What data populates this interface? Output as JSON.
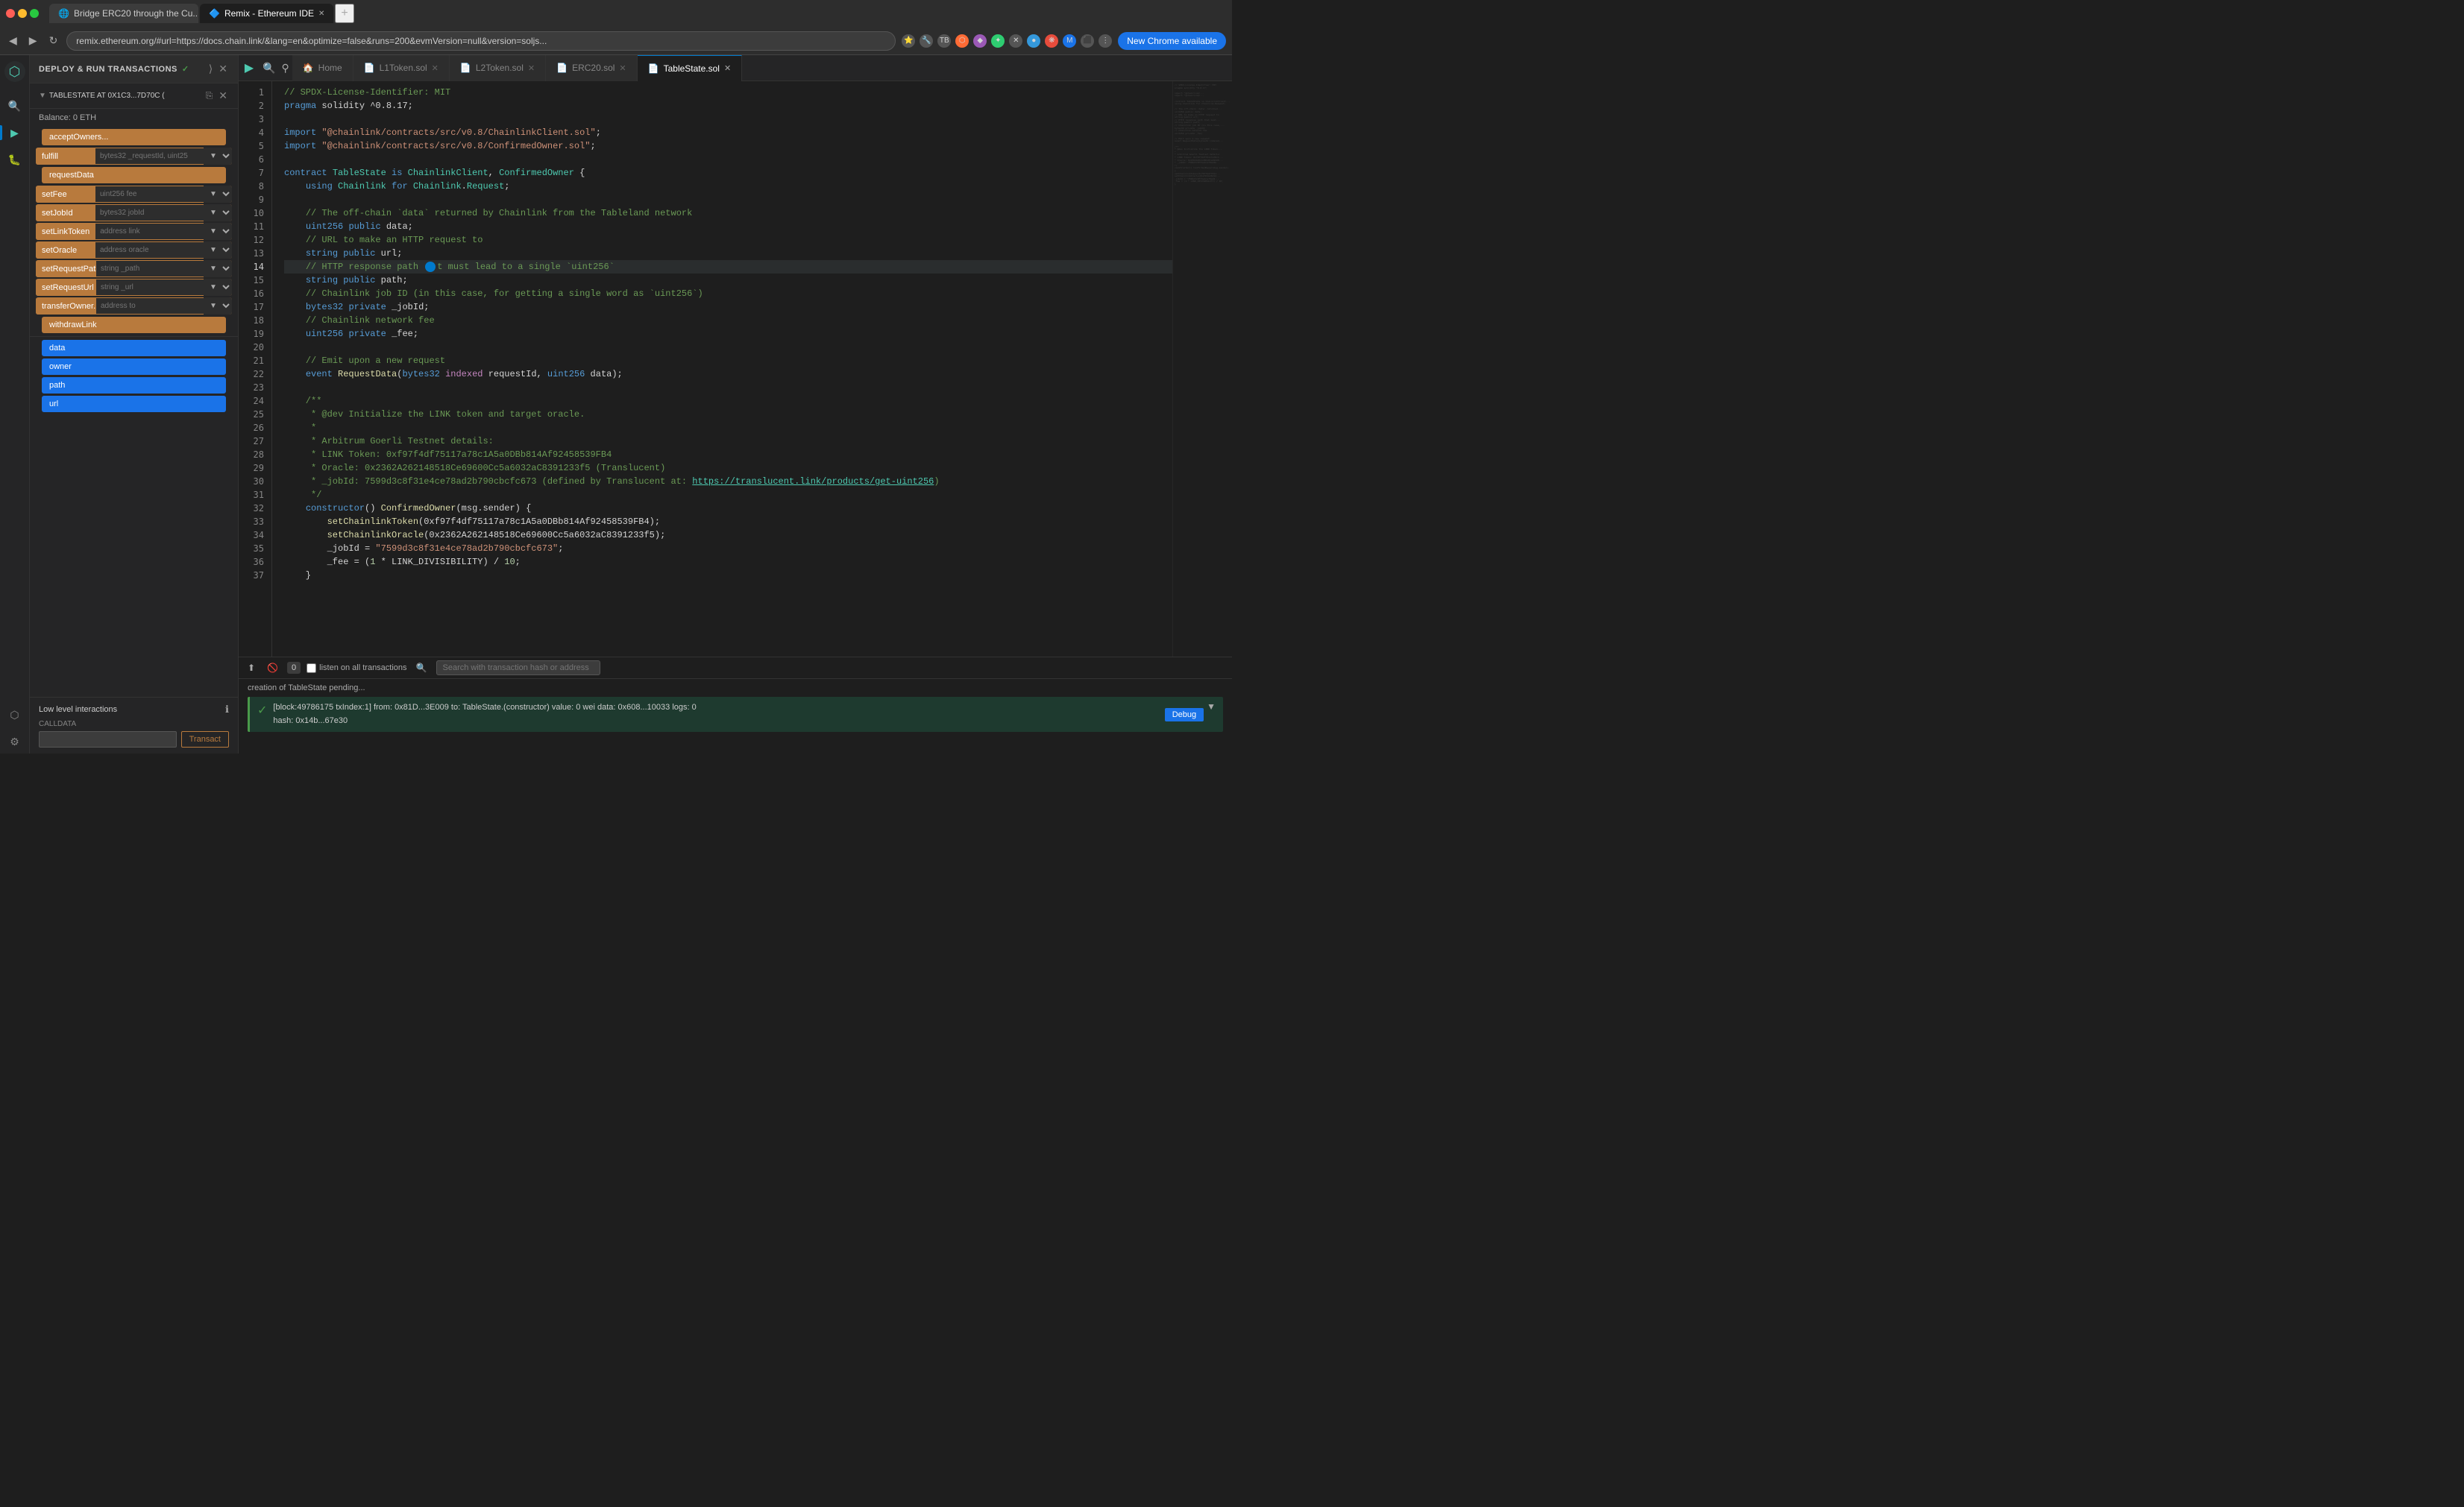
{
  "browser": {
    "tabs": [
      {
        "id": "tab1",
        "title": "Bridge ERC20 through the Cu...",
        "favicon": "🌐",
        "active": false
      },
      {
        "id": "tab2",
        "title": "Remix - Ethereum IDE",
        "favicon": "🔷",
        "active": true
      }
    ],
    "address": "remix.ethereum.org/#url=https://docs.chain.link/&lang=en&optimize=false&runs=200&evmVersion=null&version=soljs...",
    "new_chrome_label": "New Chrome available",
    "nav": {
      "back": "◀",
      "forward": "▶",
      "refresh": "↻",
      "home": "⌂"
    }
  },
  "panel": {
    "title": "DEPLOY & RUN TRANSACTIONS",
    "check_icon": "✓",
    "contract_name": "TABLESTATE AT 0X1C3...7D70C (",
    "balance": "Balance: 0 ETH",
    "buttons": [
      {
        "id": "acceptOwners",
        "label": "acceptOwners...",
        "type": "orange",
        "has_input": false
      },
      {
        "id": "fulfill",
        "label": "fulfill",
        "type": "orange",
        "has_input": true,
        "placeholder": "bytes32 _requestId, uint25"
      },
      {
        "id": "requestData",
        "label": "requestData",
        "type": "orange",
        "has_input": false
      },
      {
        "id": "setFee",
        "label": "setFee",
        "type": "orange",
        "has_input": true,
        "placeholder": "uint256 fee"
      },
      {
        "id": "setJobId",
        "label": "setJobId",
        "type": "orange",
        "has_input": true,
        "placeholder": "bytes32 jobId"
      },
      {
        "id": "setLinkToken",
        "label": "setLinkToken",
        "type": "orange",
        "has_input": true,
        "placeholder": "address link"
      },
      {
        "id": "setOracle",
        "label": "setOracle",
        "type": "orange",
        "has_input": true,
        "placeholder": "address oracle"
      },
      {
        "id": "setRequestPath",
        "label": "setRequestPath",
        "type": "orange",
        "has_input": true,
        "placeholder": "string _path"
      },
      {
        "id": "setRequestUrl",
        "label": "setRequestUrl",
        "type": "orange",
        "has_input": true,
        "placeholder": "string _url"
      },
      {
        "id": "transferOwner...",
        "label": "transferOwner...",
        "type": "orange",
        "has_input": true,
        "placeholder": "address to"
      },
      {
        "id": "withdrawLink",
        "label": "withdrawLink",
        "type": "orange",
        "has_input": false
      },
      {
        "id": "data",
        "label": "data",
        "type": "blue",
        "has_input": false
      },
      {
        "id": "owner",
        "label": "owner",
        "type": "blue",
        "has_input": false
      },
      {
        "id": "path",
        "label": "path",
        "type": "blue",
        "has_input": false
      },
      {
        "id": "url",
        "label": "url",
        "type": "blue",
        "has_input": false
      }
    ],
    "low_level": {
      "title": "Low level interactions",
      "calldata_label": "CALLDATA",
      "transact_label": "Transact"
    }
  },
  "editor": {
    "tabs": [
      {
        "id": "home",
        "label": "Home",
        "icon": "🏠",
        "active": false
      },
      {
        "id": "l1token",
        "label": "L1Token.sol",
        "icon": "📄",
        "active": false
      },
      {
        "id": "l2token",
        "label": "L2Token.sol",
        "icon": "📄",
        "active": false
      },
      {
        "id": "erc20",
        "label": "ERC20.sol",
        "icon": "📄",
        "active": false
      },
      {
        "id": "tablestate",
        "label": "TableState.sol",
        "icon": "📄",
        "active": true
      }
    ],
    "code_lines": [
      {
        "num": 1,
        "text": "// SPDX-License-Identifier: MIT"
      },
      {
        "num": 2,
        "text": "pragma solidity ^0.8.17;"
      },
      {
        "num": 3,
        "text": ""
      },
      {
        "num": 4,
        "text": "import \"@chainlink/contracts/src/v0.8/ChainlinkClient.sol\";"
      },
      {
        "num": 5,
        "text": "import \"@chainlink/contracts/src/v0.8/ConfirmedOwner.sol\";"
      },
      {
        "num": 6,
        "text": ""
      },
      {
        "num": 7,
        "text": "contract TableState is ChainlinkClient, ConfirmedOwner {"
      },
      {
        "num": 8,
        "text": "    using Chainlink for Chainlink.Request;"
      },
      {
        "num": 9,
        "text": ""
      },
      {
        "num": 10,
        "text": "    // The off-chain `data` returned by Chainlink from the Tableland network"
      },
      {
        "num": 11,
        "text": "    uint256 public data;"
      },
      {
        "num": 12,
        "text": "    // URL to make an HTTP request to"
      },
      {
        "num": 13,
        "text": "    string public url;"
      },
      {
        "num": 14,
        "text": "    // HTTP response path that must lead to a single `uint256`",
        "highlighted": true
      },
      {
        "num": 15,
        "text": "    string public path;"
      },
      {
        "num": 16,
        "text": "    // Chainlink job ID (in this case, for getting a single word as `uint256`)"
      },
      {
        "num": 17,
        "text": "    bytes32 private _jobId;"
      },
      {
        "num": 18,
        "text": "    // Chainlink network fee"
      },
      {
        "num": 19,
        "text": "    uint256 private _fee;"
      },
      {
        "num": 20,
        "text": ""
      },
      {
        "num": 21,
        "text": "    // Emit upon a new request"
      },
      {
        "num": 22,
        "text": "    event RequestData(bytes32 indexed requestId, uint256 data);"
      },
      {
        "num": 23,
        "text": ""
      },
      {
        "num": 24,
        "text": "    /**"
      },
      {
        "num": 25,
        "text": "     * @dev Initialize the LINK token and target oracle."
      },
      {
        "num": 26,
        "text": "     *"
      },
      {
        "num": 27,
        "text": "     * Arbitrum Goerli Testnet details:"
      },
      {
        "num": 28,
        "text": "     * LINK Token: 0xf97f4df75117a78c1A5a0DBb814Af92458539FB4"
      },
      {
        "num": 29,
        "text": "     * Oracle: 0x2362A262148518Ce69600Cc5a6032aC8391233f5 (Translucent)"
      },
      {
        "num": 30,
        "text": "     * _jobId: 7599d3c8f31e4ce78ad2b790cbcfc673 (defined by Translucent at: https://translucent.link/products/get-uint256)"
      },
      {
        "num": 31,
        "text": "     */"
      },
      {
        "num": 32,
        "text": "    constructor() ConfirmedOwner(msg.sender) {"
      },
      {
        "num": 33,
        "text": "        setChainlinkToken(0xf97f4df75117a78c1A5a0DBb814Af92458539FB4);"
      },
      {
        "num": 34,
        "text": "        setChainlinkOracle(0x2362A262148518Ce69600Cc5a6032aC8391233f5);"
      },
      {
        "num": 35,
        "text": "        _jobId = \"7599d3c8f31e4ce78ad2b790cbcfc673\";"
      },
      {
        "num": 36,
        "text": "        _fee = (1 * LINK_DIVISIBILITY) / 10;"
      },
      {
        "num": 37,
        "text": "    }"
      }
    ]
  },
  "bottom": {
    "transaction_count": "0",
    "listen_label": "listen on all transactions",
    "search_placeholder": "Search with transaction hash or address",
    "pending_message": "creation of TableState pending...",
    "transaction": {
      "block": "[block:49786175 txIndex:1]",
      "from": "from: 0x81D...3E009",
      "to": "to: TableState.(constructor)",
      "value": "value: 0 wei",
      "data": "data: 0x608...10033",
      "logs": "logs: 0",
      "hash": "hash: 0x14b...67e30",
      "debug_label": "Debug"
    }
  },
  "activity_icons": [
    {
      "id": "remix-logo",
      "icon": "⬡",
      "active": false
    },
    {
      "id": "search",
      "icon": "🔍",
      "active": false
    },
    {
      "id": "deploy",
      "icon": "▶",
      "active": true
    },
    {
      "id": "debug",
      "icon": "🐛",
      "active": false
    },
    {
      "id": "settings",
      "icon": "⚙",
      "active": false
    }
  ]
}
